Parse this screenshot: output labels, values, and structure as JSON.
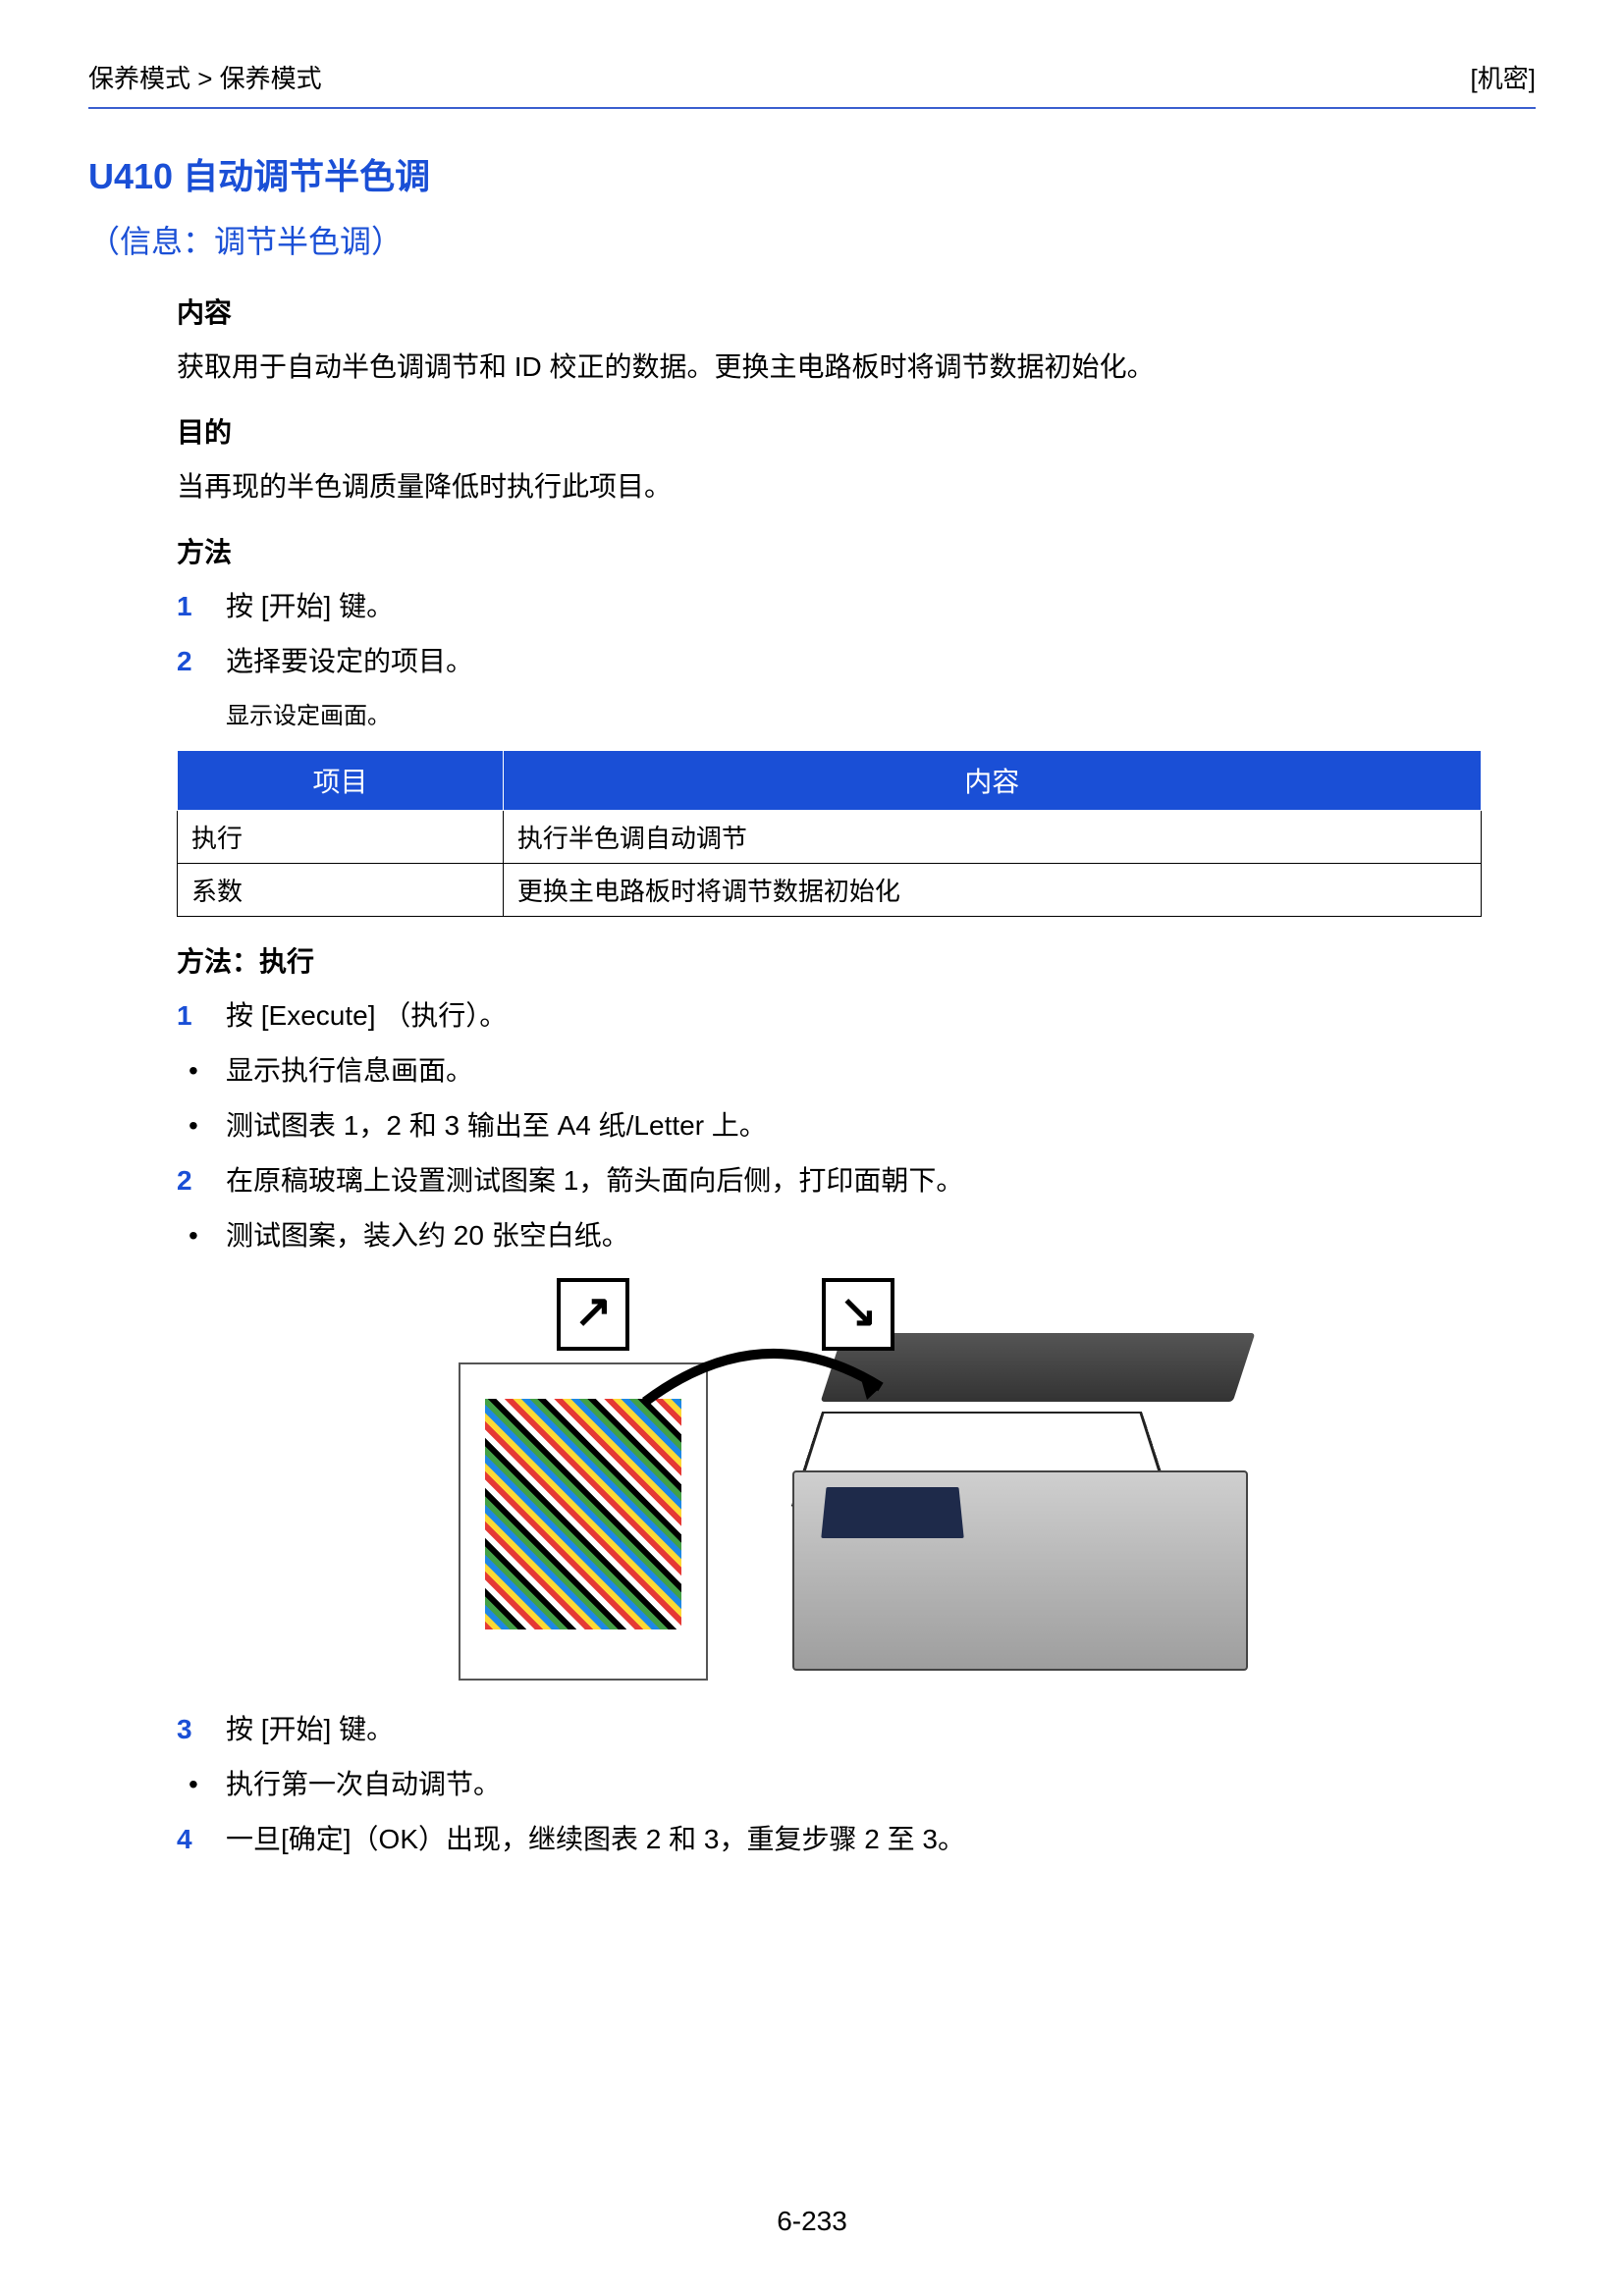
{
  "header": {
    "breadcrumb": "保养模式 > 保养模式",
    "confidential": "[机密]"
  },
  "title": {
    "main": "U410 自动调节半色调",
    "sub": "（信息：调节半色调）"
  },
  "content": {
    "heading_content": "内容",
    "text_content": "获取用于自动半色调调节和 ID 校正的数据。更换主电路板时将调节数据初始化。",
    "heading_purpose": "目的",
    "text_purpose": "当再现的半色调质量降低时执行此项目。",
    "heading_method": "方法",
    "step1": "按 [开始] 键。",
    "step2": "选择要设定的项目。",
    "step2_sub": "显示设定画面。"
  },
  "table": {
    "head_item": "项目",
    "head_desc": "内容",
    "rows": [
      {
        "item": "执行",
        "desc": "执行半色调自动调节"
      },
      {
        "item": "系数",
        "desc": "更换主电路板时将调节数据初始化"
      }
    ]
  },
  "exec": {
    "heading": "方法：执行",
    "s1": "按 [Execute] （执行）。",
    "s1b1": "显示执行信息画面。",
    "s1b2": "测试图表 1，2 和 3 输出至 A4 纸/Letter 上。",
    "s2": "在原稿玻璃上设置测试图案 1，箭头面向后侧，打印面朝下。",
    "s2b1": "测试图案，装入约 20 张空白纸。",
    "s3": "按 [开始] 键。",
    "s3b1": "执行第一次自动调节。",
    "s4": "一旦[确定]（OK）出现，继续图表 2 和 3，重复步骤 2 至 3。"
  },
  "page_number": "6-233"
}
